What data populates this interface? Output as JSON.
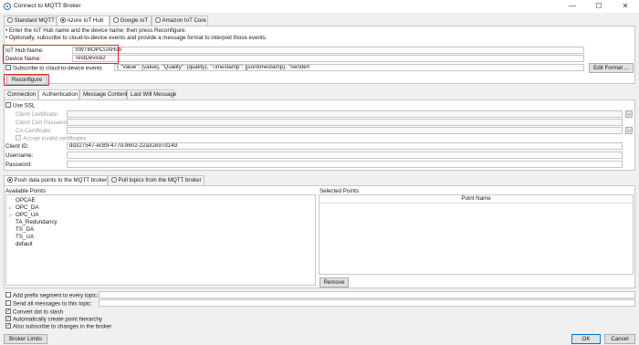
{
  "window": {
    "title": "Connect to MQTT Broker",
    "minimize": "—",
    "maximize": "☐",
    "close": "✕"
  },
  "broker_tabs": [
    {
      "label": "Standard MQTT",
      "selected": false
    },
    {
      "label": "Azure IoT Hub",
      "selected": true
    },
    {
      "label": "Google IoT",
      "selected": false
    },
    {
      "label": "Amazon IoT Core",
      "selected": false
    }
  ],
  "instructions": {
    "line1": "• Enter the IoT Hub name and the device name; then press Reconfigure.",
    "line2": "• Optionally, subscribe to cloud-to-device events and provide a message format to interpret those events."
  },
  "iot_hub": {
    "hub_label": "IoT Hub Name:",
    "hub_value": "SWTBOPCUAHub",
    "device_label": "Device Name:",
    "device_value": "TestDevice2",
    "subscribe_label": "Subscribe to cloud-to-device events",
    "subscribe_checked": false,
    "message_format": "{ \"Value\": {value}, \"Quality\": {quality}, \"Timestamp\": {jsontimestamp}, \"SenderI",
    "edit_format_label": "Edit Format ...",
    "reconfigure_label": "Reconfigure"
  },
  "settings_tabs": [
    {
      "label": "Connection",
      "selected": false
    },
    {
      "label": "Authentication",
      "selected": true
    },
    {
      "label": "Message Content",
      "selected": false
    },
    {
      "label": "Last Will Message",
      "selected": false
    }
  ],
  "auth": {
    "use_ssl_label": "Use SSL",
    "use_ssl_checked": false,
    "client_cert_label": "Client Certificate:",
    "client_cert_pw_label": "Client Cert Password:",
    "ca_cert_label": "CA Certificate:",
    "browse_label": "...",
    "accept_invalid_label": "Accept invalid certificates",
    "client_id_label": "Client ID:",
    "client_id_value": "dd327547-ec89-477d-9602-22a32e97d14d",
    "username_label": "Username:",
    "username_value": "",
    "password_label": "Password:",
    "password_value": ""
  },
  "mode_tabs": [
    {
      "label": "Push data points to the MQTT broker",
      "selected": true
    },
    {
      "label": "Pull topics from the MQTT broker",
      "selected": false
    }
  ],
  "available_points": {
    "header": "Available Points",
    "items": [
      {
        "label": "OPCAE",
        "expandable": false
      },
      {
        "label": "OPC_DA",
        "expandable": true
      },
      {
        "label": "OPC_UA",
        "expandable": true
      },
      {
        "label": "TA_Redundancy",
        "expandable": false
      },
      {
        "label": "TS_DA",
        "expandable": false
      },
      {
        "label": "TS_UA",
        "expandable": false
      },
      {
        "label": "default",
        "expandable": false
      }
    ]
  },
  "selected_points": {
    "header": "Selected Points",
    "column": "Point Name",
    "remove_label": "Remove"
  },
  "options": {
    "prefix_label": "Add prefix segment to every topic:",
    "prefix_checked": false,
    "send_all_label": "Send all messages to this topic:",
    "send_all_checked": false,
    "dot_slash_label": "Convert dot to slash",
    "dot_slash_checked": true,
    "hierarchy_label": "Automatically create point hierarchy",
    "hierarchy_checked": true,
    "subscribe_changes_label": "Also subscribe to changes in the broker",
    "subscribe_changes_checked": true
  },
  "footer": {
    "broker_limits_label": "Broker Limits",
    "ok_label": "OK",
    "cancel_label": "Cancel"
  },
  "colors": {
    "highlight_border": "#d62828",
    "background": "#f0f0f0"
  }
}
